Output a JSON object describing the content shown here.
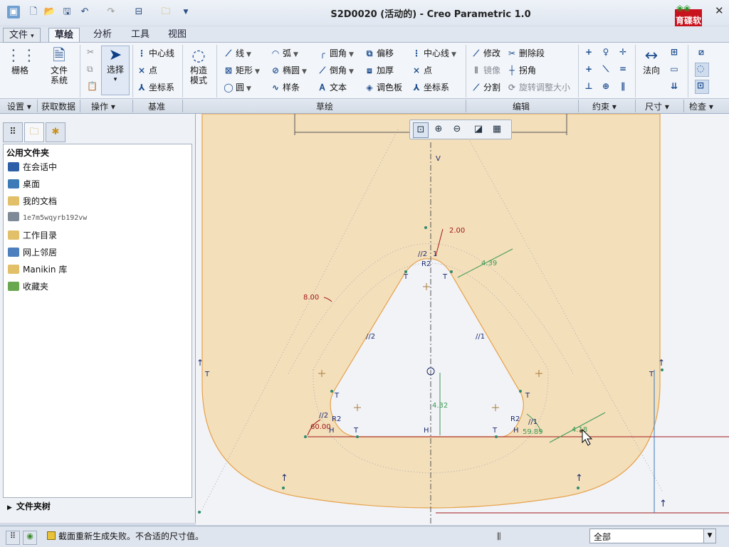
{
  "window": {
    "title": "S2D0020 (活动的) - Creo Parametric 1.0",
    "logo_text": "育碟软件"
  },
  "quick_access": [
    "new-icon",
    "open-icon",
    "save-icon",
    "undo-icon",
    "redo-icon",
    "window-icon",
    "folder-icon"
  ],
  "menu": {
    "file": "文件",
    "tabs": [
      "草绘",
      "分析",
      "工具",
      "视图"
    ],
    "active_tab": "草绘"
  },
  "ribbon": {
    "setup": {
      "grid": "栅格",
      "file_system": "文件系统"
    },
    "operations": {
      "select": "选择"
    },
    "datum": {
      "centerline": "中心线",
      "point": "点",
      "coordsys": "坐标系",
      "construction_mode": "构造模式"
    },
    "sketch": {
      "line": "线",
      "arc": "弧",
      "fillet": "圆角",
      "offset": "偏移",
      "rectangle": "矩形",
      "ellipse": "椭圆",
      "chamfer": "倒角",
      "thicken": "加厚",
      "circle": "圆",
      "spline": "样条",
      "text": "文本",
      "palette": "调色板",
      "centerline": "中心线",
      "point": "点",
      "coordsys": "坐标系"
    },
    "edit": {
      "modify": "修改",
      "delete_segment": "删除段",
      "mirror": "镜像",
      "corner": "拐角",
      "divide": "分割",
      "rotate_resize": "旋转调整大小"
    },
    "dimension": {
      "normal": "法向"
    },
    "groups": {
      "setup": "设置",
      "get_data": "获取数据",
      "operations": "操作",
      "datum": "基准",
      "sketch": "草绘",
      "edit": "编辑",
      "constrain": "约束",
      "dimension": "尺寸",
      "inspect": "检查"
    }
  },
  "left_panel": {
    "header": "公用文件夹",
    "items": [
      "在会话中",
      "桌面",
      "我的文档",
      "1e7m5wqyrb192vw",
      "工作目录",
      "网上邻居",
      "Manikin 库",
      "收藏夹"
    ],
    "folder_tree": "文件夹树"
  },
  "sketch": {
    "dims": {
      "d_top_offset": "2.00",
      "d_top_right": "4.39",
      "d_left_offset": "8.00",
      "d_vertical": "4.32",
      "d_angle_left": "60.00",
      "d_angle_right": "59.89",
      "d_right_offset": "4.18",
      "radius_top": "R2",
      "radius_left": "R2",
      "radius_right": "R2"
    },
    "constraints": {
      "tangent": "T",
      "horizontal": "H",
      "vertical": "V",
      "parallel_left": "//2",
      "parallel_right": "//1",
      "parallel_top_1": "//2",
      "parallel_top_2": "1",
      "parallel_bl": "//2",
      "parallel_br": "//1"
    },
    "colors": {
      "fill": "#f4dfbb",
      "outline": "#e5a24a",
      "dimension_weak": "#3c9a55",
      "dimension_strong": "#a01818",
      "constraint": "#1b2a6e",
      "centerline": "#555555"
    }
  },
  "status": {
    "message": "截面重新生成失败。不合适的尺寸值。",
    "filter": "全部"
  }
}
